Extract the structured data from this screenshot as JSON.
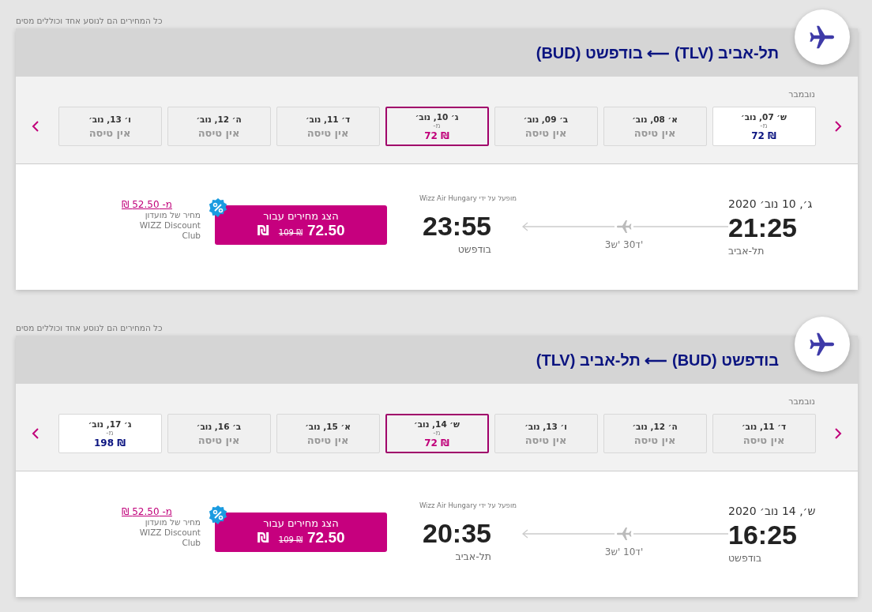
{
  "sections": [
    {
      "note": "כל המחירים הם לנוסע אחד וכוללים מסים",
      "title": "תל-אביב (TLV) ⟵ בודפשט (BUD)",
      "month": "נובמבר",
      "days": [
        {
          "kind": "flight",
          "date": "ש׳ 07, נוב׳",
          "from": "מ-",
          "price": "72 ₪",
          "selected": false
        },
        {
          "kind": "none",
          "date": "א׳ 08, נוב׳",
          "status": "אין טיסה",
          "selected": false
        },
        {
          "kind": "none",
          "date": "ב׳ 09, נוב׳",
          "status": "אין טיסה",
          "selected": false
        },
        {
          "kind": "flight",
          "date": "ג׳ 10, נוב׳",
          "from": "מ-",
          "price": "72 ₪",
          "selected": true
        },
        {
          "kind": "none",
          "date": "ד׳ 11, נוב׳",
          "status": "אין טיסה",
          "selected": false
        },
        {
          "kind": "none",
          "date": "ה׳ 12, נוב׳",
          "status": "אין טיסה",
          "selected": false
        },
        {
          "kind": "none",
          "date": "ו׳ 13, נוב׳",
          "status": "אין טיסה",
          "selected": false
        }
      ],
      "flight": {
        "date": "ג׳, 10 נוב׳ 2020",
        "departure_time": "21:25",
        "departure_city": "תל-אביב",
        "duration": "3ש' 30ד'",
        "operator": "מופעל על ידי Wizz Air Hungary",
        "arrival_time": "23:55",
        "arrival_city": "בודפשט",
        "button": {
          "label": "הצג מחירים עבור",
          "price": "72.50",
          "old_price": "109 ₪",
          "currency": "₪"
        },
        "club_price": "מ- 52.50 ₪",
        "club_text": "מחיר של מועדון WIZZ Discount Club"
      }
    },
    {
      "note": "כל המחירים הם לנוסע אחד וכוללים מסים",
      "title": "בודפשט (BUD) ⟵ תל-אביב (TLV)",
      "month": "נובמבר",
      "days": [
        {
          "kind": "none",
          "date": "ד׳ 11, נוב׳",
          "status": "אין טיסה",
          "selected": false
        },
        {
          "kind": "none",
          "date": "ה׳ 12, נוב׳",
          "status": "אין טיסה",
          "selected": false
        },
        {
          "kind": "none",
          "date": "ו׳ 13, נוב׳",
          "status": "אין טיסה",
          "selected": false
        },
        {
          "kind": "flight",
          "date": "ש׳ 14, נוב׳",
          "from": "מ-",
          "price": "72 ₪",
          "selected": true
        },
        {
          "kind": "none",
          "date": "א׳ 15, נוב׳",
          "status": "אין טיסה",
          "selected": false
        },
        {
          "kind": "none",
          "date": "ב׳ 16, נוב׳",
          "status": "אין טיסה",
          "selected": false
        },
        {
          "kind": "flight",
          "date": "ג׳ 17, נוב׳",
          "from": "מ-",
          "price": "198 ₪",
          "selected": false
        }
      ],
      "flight": {
        "date": "ש׳, 14 נוב׳ 2020",
        "departure_time": "16:25",
        "departure_city": "בודפשט",
        "duration": "3ש' 10ד'",
        "operator": "מופעל על ידי Wizz Air Hungary",
        "arrival_time": "20:35",
        "arrival_city": "תל-אביב",
        "button": {
          "label": "הצג מחירים עבור",
          "price": "72.50",
          "old_price": "109 ₪",
          "currency": "₪"
        },
        "club_price": "מ- 52.50 ₪",
        "club_text": "מחיר של מועדון WIZZ Discount Club"
      }
    }
  ]
}
